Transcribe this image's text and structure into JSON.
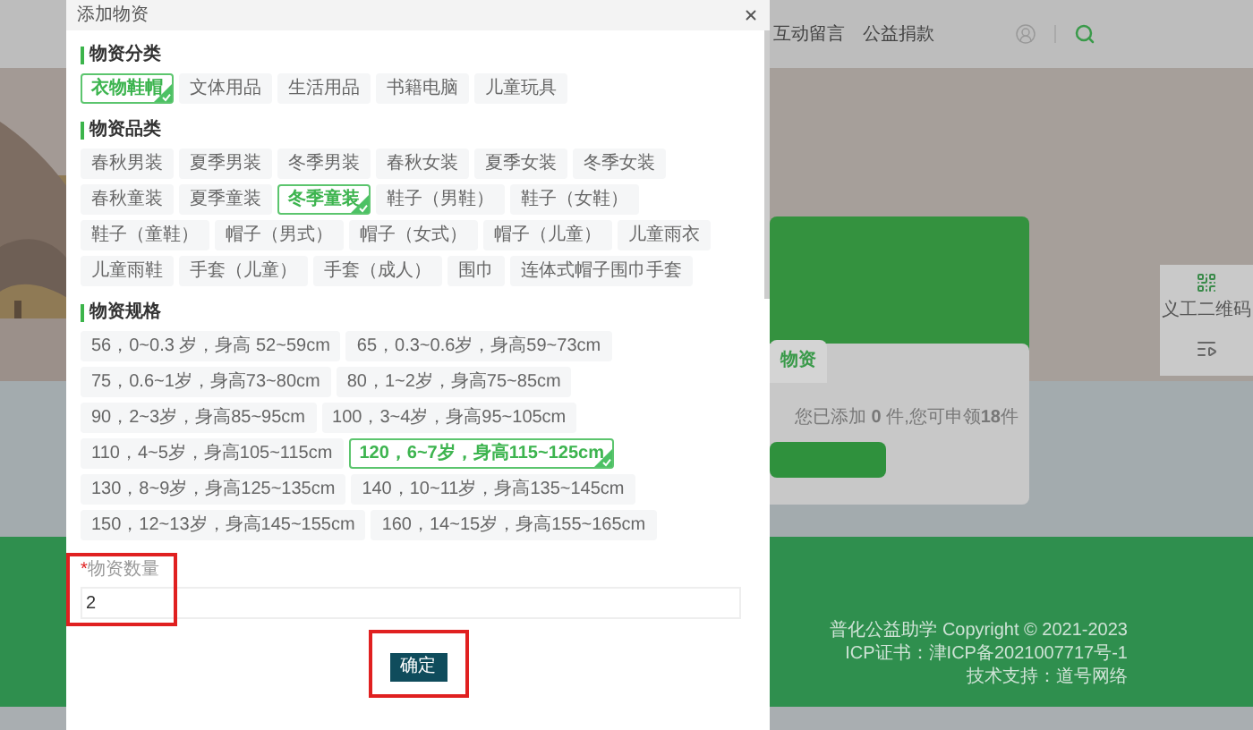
{
  "background": {
    "nav": [
      "互动留言",
      "公益捐款"
    ],
    "card_tab": "物资",
    "summary": "您已添加 **0** 件,您可申领**18**件",
    "side_widget": {
      "label": "义工二维码"
    },
    "footer": [
      "普化公益助学 Copyright © 2021-2023",
      "ICP证书：津ICP备2021007717号-1",
      "技术支持：道号网络"
    ]
  },
  "dialog": {
    "title": "添加物资",
    "sections": [
      {
        "title": "物资分类",
        "options": [
          {
            "label": "衣物鞋帽",
            "selected": true
          },
          {
            "label": "文体用品",
            "selected": false
          },
          {
            "label": "生活用品",
            "selected": false
          },
          {
            "label": "书籍电脑",
            "selected": false
          },
          {
            "label": "儿童玩具",
            "selected": false
          }
        ]
      },
      {
        "title": "物资品类",
        "options": [
          {
            "label": "春秋男装",
            "selected": false
          },
          {
            "label": "夏季男装",
            "selected": false
          },
          {
            "label": "冬季男装",
            "selected": false
          },
          {
            "label": "春秋女装",
            "selected": false
          },
          {
            "label": "夏季女装",
            "selected": false
          },
          {
            "label": "冬季女装",
            "selected": false
          },
          {
            "label": "春秋童装",
            "selected": false
          },
          {
            "label": "夏季童装",
            "selected": false
          },
          {
            "label": "冬季童装",
            "selected": true
          },
          {
            "label": "鞋子（男鞋）",
            "selected": false
          },
          {
            "label": "鞋子（女鞋）",
            "selected": false
          },
          {
            "label": "鞋子（童鞋）",
            "selected": false
          },
          {
            "label": "帽子（男式）",
            "selected": false
          },
          {
            "label": "帽子（女式）",
            "selected": false
          },
          {
            "label": "帽子（儿童）",
            "selected": false
          },
          {
            "label": "儿童雨衣",
            "selected": false
          },
          {
            "label": "儿童雨鞋",
            "selected": false
          },
          {
            "label": "手套（儿童）",
            "selected": false
          },
          {
            "label": "手套（成人）",
            "selected": false
          },
          {
            "label": "围巾",
            "selected": false
          },
          {
            "label": "连体式帽子围巾手套",
            "selected": false
          }
        ]
      },
      {
        "title": "物资规格",
        "options": [
          {
            "label": "56，0~0.3 岁，身高 52~59cm",
            "selected": false
          },
          {
            "label": "65，0.3~0.6岁，身高59~73cm",
            "selected": false
          },
          {
            "label": "75，0.6~1岁，身高73~80cm",
            "selected": false
          },
          {
            "label": "80，1~2岁，身高75~85cm",
            "selected": false
          },
          {
            "label": "90，2~3岁，身高85~95cm",
            "selected": false
          },
          {
            "label": "100，3~4岁，身高95~105cm",
            "selected": false
          },
          {
            "label": "110，4~5岁，身高105~115cm",
            "selected": false
          },
          {
            "label": "120，6~7岁，身高115~125cm",
            "selected": true
          },
          {
            "label": "130，8~9岁，身高125~135cm",
            "selected": false
          },
          {
            "label": "140，10~11岁，身高135~145cm",
            "selected": false
          },
          {
            "label": "150，12~13岁，身高145~155cm",
            "selected": false
          },
          {
            "label": "160，14~15岁，身高155~165cm",
            "selected": false
          }
        ]
      }
    ],
    "quantity": {
      "required_mark": "*",
      "label": "物资数量",
      "value": "2",
      "highlighted": true
    },
    "confirm": {
      "label": "确定",
      "highlighted": true
    }
  }
}
